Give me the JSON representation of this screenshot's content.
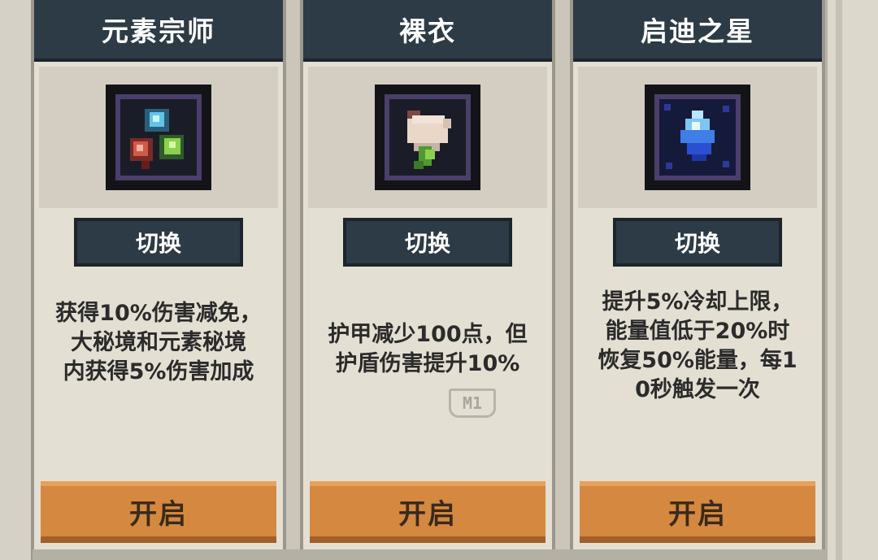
{
  "cards": [
    {
      "title": "元素宗师",
      "switch_label": "切换",
      "description": "获得10%伤害减免，\n大秘境和元素秘境\n内获得5%伤害加成",
      "open_label": "开启",
      "icon": "elemental-gems-icon"
    },
    {
      "title": "裸衣",
      "switch_label": "切换",
      "description": "护甲减少100点，但\n护盾伤害提升10%",
      "open_label": "开启",
      "icon": "bare-cloth-icon"
    },
    {
      "title": "启迪之星",
      "switch_label": "切换",
      "description": "提升5%冷却上限，\n能量值低于20%时\n恢复50%能量，每1\n0秒触发一次",
      "open_label": "开启",
      "icon": "blue-star-crystal-icon"
    }
  ],
  "badge": "M1",
  "colors": {
    "header": "#2c3b45",
    "card_bg": "#e4dfd3",
    "open_button": "#d48840",
    "item_frame_border": "#4a3f6b"
  }
}
